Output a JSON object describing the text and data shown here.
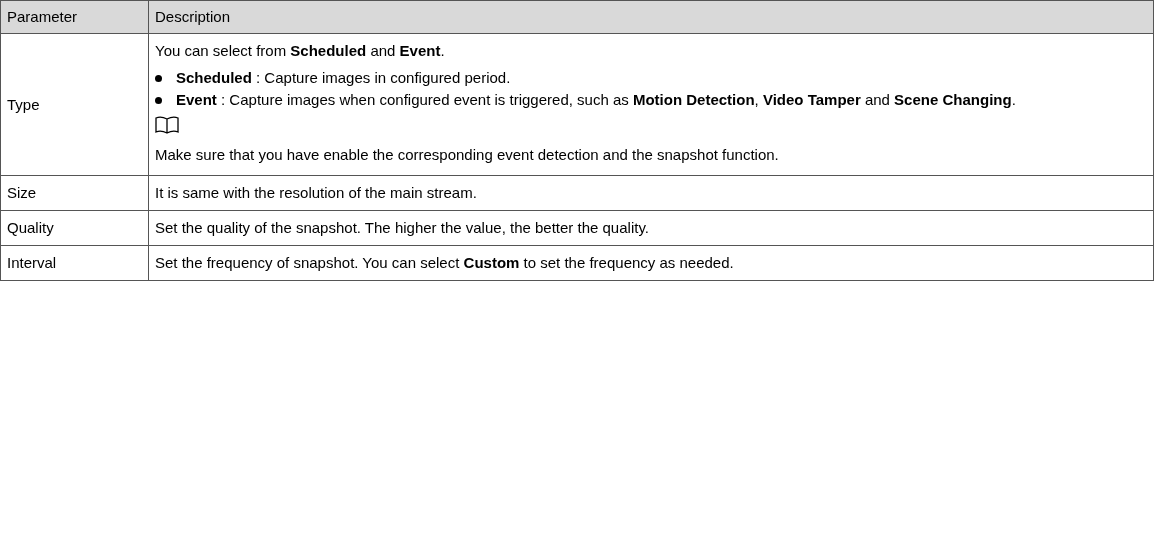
{
  "table": {
    "columns": [
      "Parameter",
      "Description"
    ],
    "rows": [
      {
        "parameter": "Type",
        "description": [
          {
            "kind": "paragraph",
            "text": "You can select from **Scheduled**  and **Event**."
          },
          {
            "kind": "bullets",
            "items": [
              "**Scheduled** : Capture images in configured period.",
              "**Event** : Capture images when configured event is triggered, such as **Motion Detection**, **Video Tamper** and **Scene Changing**."
            ]
          },
          {
            "kind": "note",
            "text": "Make sure that you have enable the corresponding event detection and the snapshot function."
          }
        ]
      },
      {
        "parameter": "Size",
        "description": [
          {
            "kind": "paragraph",
            "text": "It is same with the resolution of the main stream."
          }
        ]
      },
      {
        "parameter": "Quality",
        "description": [
          {
            "kind": "paragraph",
            "text": "Set the quality of the snapshot. The higher the value, the better the quality."
          }
        ]
      },
      {
        "parameter": "Interval",
        "description": [
          {
            "kind": "paragraph",
            "text": "Set the frequency of snapshot. You can select **Custom**  to set the frequency as needed."
          }
        ]
      }
    ]
  }
}
